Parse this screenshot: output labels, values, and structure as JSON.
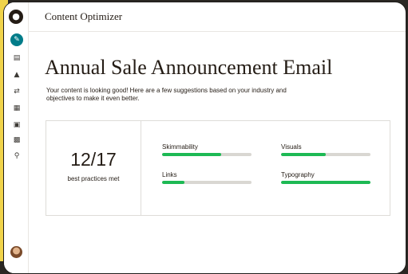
{
  "app": {
    "title": "Content Optimizer"
  },
  "sidebar": {
    "icons": [
      "pencil-icon",
      "contacts-icon",
      "campaigns-icon",
      "automations-icon",
      "website-icon",
      "content-icon",
      "integrations-icon",
      "search-icon"
    ]
  },
  "main": {
    "heading": "Annual Sale Announcement Email",
    "intro": "Your content is looking good! Here are a few suggestions based on your industry and objectives to make it even better."
  },
  "summary": {
    "score": "12/17",
    "score_label": "best practices met",
    "metrics": [
      {
        "label": "Skimmability",
        "progress": 0.66
      },
      {
        "label": "Visuals",
        "progress": 0.5
      },
      {
        "label": "Links",
        "progress": 0.25
      },
      {
        "label": "Typography",
        "progress": 1.0
      }
    ]
  },
  "colors": {
    "accent": "#007c89",
    "progress_fill": "#1db954",
    "progress_track": "#d9d7d2"
  }
}
